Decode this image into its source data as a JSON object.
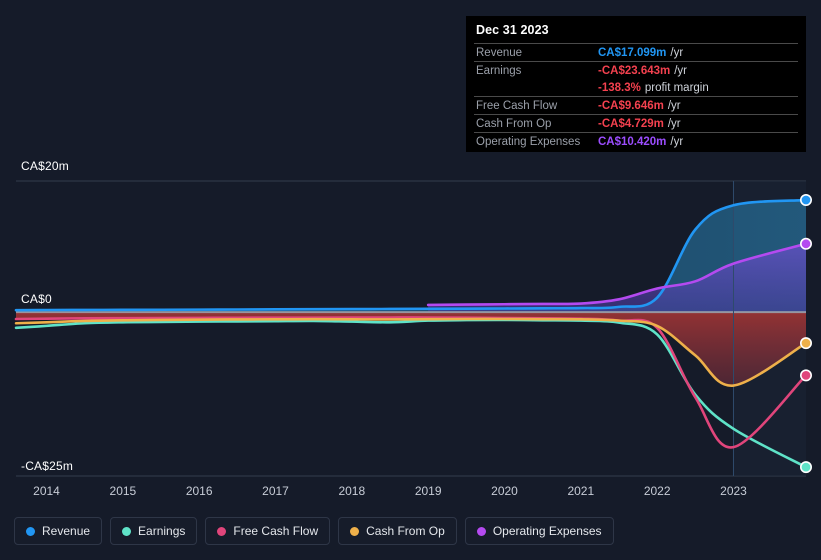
{
  "chart_data": {
    "type": "area",
    "title": "",
    "xlabel": "",
    "ylabel": "",
    "currency": "CA$",
    "unit": "m",
    "ylim": [
      -25,
      20
    ],
    "y_ticks": [
      {
        "value": 20,
        "label": "CA$20m"
      },
      {
        "value": 0,
        "label": "CA$0"
      },
      {
        "value": -25,
        "label": "-CA$25m"
      }
    ],
    "x_ticks": [
      "2014",
      "2015",
      "2016",
      "2017",
      "2018",
      "2019",
      "2020",
      "2021",
      "2022",
      "2023"
    ],
    "x": [
      2013.6,
      2014,
      2014.5,
      2015,
      2015.5,
      2016,
      2016.5,
      2017,
      2017.5,
      2018,
      2018.5,
      2019,
      2019.5,
      2020,
      2020.5,
      2021,
      2021.5,
      2022,
      2022.5,
      2023,
      2023.95
    ],
    "grid": true,
    "legend_position": "bottom",
    "series": [
      {
        "name": "Revenue",
        "color": "#2196f3",
        "fill": "rgba(33,150,243,0.20)",
        "values": [
          0.3,
          0.32,
          0.33,
          0.35,
          0.36,
          0.38,
          0.4,
          0.42,
          0.44,
          0.46,
          0.48,
          0.5,
          0.52,
          0.55,
          0.58,
          0.62,
          0.8,
          2.2,
          12.6,
          16.3,
          17.099
        ],
        "end_value": 17.099,
        "end_label": "CA$17.099m"
      },
      {
        "name": "Earnings",
        "color": "#5fe3c8",
        "fill": "none",
        "values": [
          -2.4,
          -2.1,
          -1.7,
          -1.55,
          -1.5,
          -1.45,
          -1.42,
          -1.38,
          -1.35,
          -1.45,
          -1.55,
          -1.3,
          -1.22,
          -1.2,
          -1.25,
          -1.3,
          -1.6,
          -3.4,
          -12.6,
          -17.8,
          -23.643
        ],
        "end_value": -23.643,
        "end_label": "-CA$23.643m"
      },
      {
        "name": "Free Cash Flow",
        "color": "#e0457b",
        "fill": "none",
        "values": [
          -1.05,
          -1.0,
          -0.95,
          -0.92,
          -0.9,
          -0.88,
          -0.86,
          -0.85,
          -0.84,
          -0.83,
          -0.82,
          -0.82,
          -0.85,
          -0.9,
          -0.95,
          -1.0,
          -1.3,
          -2.4,
          -13.0,
          -20.6,
          -9.646
        ],
        "end_value": -9.646,
        "end_label": "-CA$9.646m"
      },
      {
        "name": "Cash From Op",
        "color": "#eeb04a",
        "fill": "none",
        "values": [
          -1.7,
          -1.55,
          -1.35,
          -1.25,
          -1.2,
          -1.15,
          -1.12,
          -1.1,
          -1.08,
          -1.1,
          -1.12,
          -1.08,
          -1.05,
          -1.05,
          -1.08,
          -1.1,
          -1.3,
          -2.1,
          -6.6,
          -11.2,
          -4.729
        ],
        "end_value": -4.729,
        "end_label": "-CA$4.729m"
      },
      {
        "name": "Operating Expenses",
        "color": "#b44af0",
        "fill": "rgba(128,80,220,0.30)",
        "values": [
          null,
          null,
          null,
          null,
          null,
          null,
          null,
          null,
          null,
          null,
          null,
          1.1,
          1.15,
          1.2,
          1.25,
          1.3,
          1.95,
          3.6,
          4.7,
          7.4,
          10.42
        ],
        "end_value": 10.42,
        "end_label": "CA$10.420m"
      }
    ]
  },
  "tooltip": {
    "date": "Dec 31 2023",
    "rows": [
      {
        "label": "Revenue",
        "value": "CA$17.099m",
        "suffix": "/yr",
        "color": "#2196f3"
      },
      {
        "label": "Earnings",
        "value": "-CA$23.643m",
        "suffix": "/yr",
        "color": "#f4414f"
      },
      {
        "label": "",
        "value": "-138.3%",
        "suffix": "profit margin",
        "color": "#f4414f"
      },
      {
        "label": "Free Cash Flow",
        "value": "-CA$9.646m",
        "suffix": "/yr",
        "color": "#f4414f"
      },
      {
        "label": "Cash From Op",
        "value": "-CA$4.729m",
        "suffix": "/yr",
        "color": "#f4414f"
      },
      {
        "label": "Operating Expenses",
        "value": "CA$10.420m",
        "suffix": "/yr",
        "color": "#9c4dff"
      }
    ]
  },
  "legend": {
    "items": [
      {
        "label": "Revenue",
        "color": "#2196f3"
      },
      {
        "label": "Earnings",
        "color": "#5fe3c8"
      },
      {
        "label": "Free Cash Flow",
        "color": "#e0457b"
      },
      {
        "label": "Cash From Op",
        "color": "#eeb04a"
      },
      {
        "label": "Operating Expenses",
        "color": "#b44af0"
      }
    ]
  },
  "colors": {
    "background": "#151b29",
    "plot_background": "#131926",
    "grid": "#3a4254",
    "zero_line": "#9aa0ab",
    "negative_fill": "rgba(180,50,50,0.55)",
    "crosshair": "#2f4a6b"
  }
}
